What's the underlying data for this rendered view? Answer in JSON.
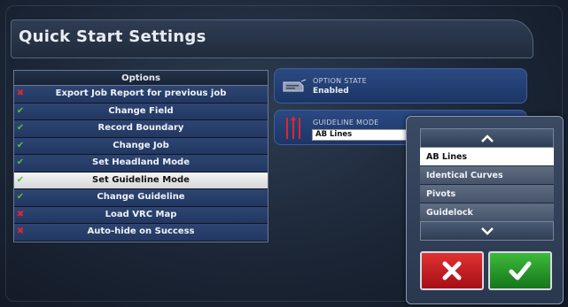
{
  "header": {
    "title": "Quick Start Settings"
  },
  "options": {
    "header": "Options",
    "rows": [
      {
        "label": "Export Job Report for previous job",
        "enabled": false,
        "selected": false
      },
      {
        "label": "Change Field",
        "enabled": true,
        "selected": false
      },
      {
        "label": "Record Boundary",
        "enabled": true,
        "selected": false
      },
      {
        "label": "Change Job",
        "enabled": true,
        "selected": false
      },
      {
        "label": "Set Headland Mode",
        "enabled": true,
        "selected": false
      },
      {
        "label": "Set Guideline Mode",
        "enabled": true,
        "selected": true
      },
      {
        "label": "Change Guideline",
        "enabled": true,
        "selected": false
      },
      {
        "label": "Load VRC Map",
        "enabled": false,
        "selected": false
      },
      {
        "label": "Auto-hide on Success",
        "enabled": false,
        "selected": false
      }
    ],
    "marks": {
      "enabled": "✔",
      "disabled": "✖"
    }
  },
  "option_state": {
    "label": "OPTION STATE",
    "value": "Enabled",
    "icon": "document-icon"
  },
  "guideline_mode": {
    "label": "GUIDELINE MODE",
    "value": "AB Lines",
    "icon": "guidelines-icon"
  },
  "dropdown": {
    "items": [
      "AB Lines",
      "Identical Curves",
      "Pivots",
      "Guidelock"
    ],
    "selected_index": 0,
    "up_icon": "chevron-up-icon",
    "down_icon": "chevron-down-icon"
  },
  "buttons": {
    "cancel_icon": "x-icon",
    "confirm_icon": "check-icon"
  },
  "colors": {
    "accent_red": "#e0262e",
    "accent_green": "#52c23c",
    "panel_blue": "#2b4a82",
    "background": "#1b2535"
  }
}
